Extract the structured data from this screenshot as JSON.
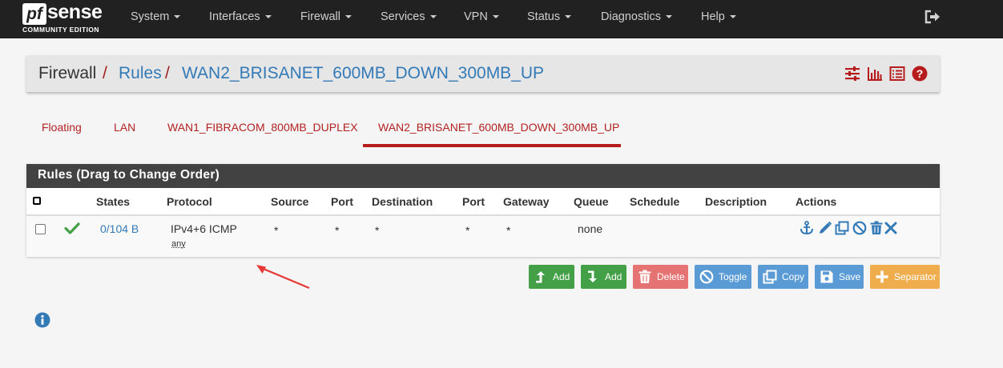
{
  "navbar": {
    "logo": {
      "pf": "pf",
      "sense": "sense",
      "edition": "COMMUNITY EDITION"
    },
    "menu": [
      {
        "label": "System"
      },
      {
        "label": "Interfaces"
      },
      {
        "label": "Firewall"
      },
      {
        "label": "Services"
      },
      {
        "label": "VPN"
      },
      {
        "label": "Status"
      },
      {
        "label": "Diagnostics"
      },
      {
        "label": "Help"
      }
    ],
    "logout_icon": "sign-out-icon"
  },
  "breadcrumb": {
    "part1": "Firewall",
    "sep1": "/",
    "part2": "Rules",
    "sep2": "/",
    "part3": "WAN2_BRISANET_600MB_DOWN_300MB_UP",
    "icons": [
      "sliders-icon",
      "bar-chart-icon",
      "list-icon",
      "question-circle-icon"
    ]
  },
  "tabs": [
    {
      "label": "Floating"
    },
    {
      "label": "LAN"
    },
    {
      "label": "WAN1_FIBRACOM_800MB_DUPLEX"
    },
    {
      "label": "WAN2_BRISANET_600MB_DOWN_300MB_UP",
      "active": true
    }
  ],
  "rules_panel": {
    "title": "Rules (Drag to Change Order)",
    "headers": {
      "states": "States",
      "protocol": "Protocol",
      "source": "Source",
      "port": "Port",
      "destination": "Destination",
      "dest_port": "Port",
      "gateway": "Gateway",
      "queue": "Queue",
      "schedule": "Schedule",
      "description": "Description",
      "actions": "Actions"
    },
    "rows": [
      {
        "status_icon": "check-icon",
        "states": "0/104 B",
        "protocol": "IPv4+6 ICMP",
        "protocol_sub": "any",
        "source": "*",
        "port": "*",
        "destination": "*",
        "dest_port": "*",
        "gateway": "*",
        "queue": "none",
        "schedule": "",
        "description": "",
        "actions": [
          "anchor-icon",
          "pencil-icon",
          "clone-icon",
          "ban-icon",
          "trash-icon",
          "times-icon"
        ]
      }
    ]
  },
  "buttons": {
    "add_top": "Add",
    "add_bottom": "Add",
    "delete": "Delete",
    "toggle": "Toggle",
    "copy": "Copy",
    "save": "Save",
    "separator": "Separator"
  },
  "colors": {
    "navbar": "#212121",
    "accent_red": "#b71c1c",
    "link_blue": "#337ab7",
    "success": "#43a047",
    "danger": "#e57373",
    "info": "#5b9bd5",
    "warning": "#f0ad4e"
  },
  "info_icon": "info-circle-icon"
}
